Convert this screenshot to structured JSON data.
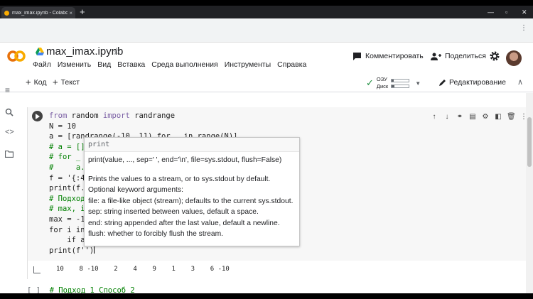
{
  "browser": {
    "tab_title": "max_imax.ipynb - Colaboratory",
    "tab_close": "×",
    "new_tab": "+",
    "window_controls": [
      "—",
      "▫",
      "✕"
    ],
    "menu_dots": "⋮"
  },
  "header": {
    "notebook_title": "max_imax.ipynb",
    "star_glyph": "☆",
    "menu": [
      "Файл",
      "Изменить",
      "Вид",
      "Вставка",
      "Среда выполнения",
      "Инструменты",
      "Справка"
    ],
    "comment_label": "Комментировать",
    "share_label": "Поделиться"
  },
  "toolbar": {
    "add_code": "Код",
    "add_text": "Текст",
    "ram_label": "ОЗУ",
    "disk_label": "Диск",
    "ram_fill": 0.1,
    "disk_fill": 0.15,
    "editing_label": "Редактирование"
  },
  "rail": {
    "icons": [
      "menu-icon",
      "search-icon",
      "code-icon",
      "folder-icon"
    ]
  },
  "cell": {
    "code_lines": [
      "from random import randrange",
      "N = 10",
      "a = [randrange(-10, 11) for _ in range(N)]",
      "# a = []",
      "# for _",
      "#     a.",
      "f = '{:4",
      "print(f.",
      "# Подход",
      "# max, i",
      "max = -1",
      "for i in",
      "    if a",
      "",
      "print(f'')"
    ],
    "output": "10    8 -10    2    4    9    1    3    6 -10"
  },
  "tooltip": {
    "name": "print",
    "signature": "print(value, ..., sep=' ', end='\\n', file=sys.stdout, flush=False)",
    "doc": [
      "Prints the values to a stream, or to sys.stdout by default.",
      "Optional keyword arguments:",
      "file:  a file-like object (stream); defaults to the current sys.stdout.",
      "sep:   string inserted between values, default a space.",
      "end:   string appended after the last value, default a newline.",
      "flush: whether to forcibly flush the stream."
    ]
  },
  "next_cell": {
    "bracket": "[ ]",
    "text": "# Подход 1 Способ 2"
  },
  "colors": {
    "accent_orange": "#f9ab00",
    "check_green": "#1e8e3e",
    "keyword": "#795da3",
    "comment": "#008000"
  }
}
